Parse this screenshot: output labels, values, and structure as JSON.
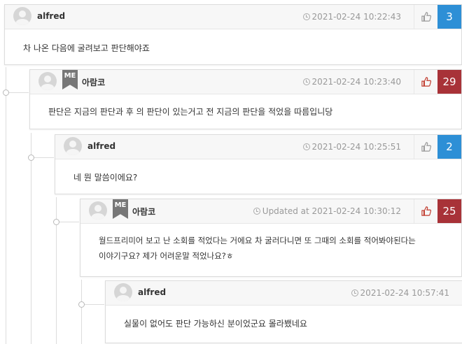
{
  "comments": [
    {
      "author": "alfred",
      "is_me": false,
      "time": "2021-02-24 10:22:43",
      "likes": "3",
      "liked": false,
      "text": "차 나온 다음에 굴려보고 판단해야죠"
    },
    {
      "author": "아람코",
      "is_me": true,
      "time": "2021-02-24 10:23:40",
      "likes": "29",
      "liked": true,
      "text": "판단은 지금의 판단과 후 의 판단이 있는거고 전 지금의 판단을 적었을 따름입니당"
    },
    {
      "author": "alfred",
      "is_me": false,
      "time": "2021-02-24 10:25:51",
      "likes": "2",
      "liked": false,
      "text": "네 뭔 말씀이에요?"
    },
    {
      "author": "아람코",
      "is_me": true,
      "time": "Updated at 2021-02-24 10:30:12",
      "likes": "25",
      "liked": true,
      "text_line1": "월드프리미어 보고 난 소회를 적었다는 거에요 차 굴러다니면 또 그때의 소회를 적어봐야된다는",
      "text_line2": "이야기구요? 제가 어려운말 적었나요?ㅎ"
    },
    {
      "author": "alfred",
      "is_me": false,
      "time": "2021-02-24 10:57:41",
      "likes": "",
      "liked": false,
      "text": "실물이 없어도 판단 가능하신 분이었군요 몰라뵀네요"
    }
  ],
  "me_badge": "ME",
  "colors": {
    "likes_default": "#2d8fd6",
    "likes_liked": "#a83238",
    "liked_icon": "#c0392b"
  },
  "icons": {
    "like": "thumbs-up-icon",
    "time": "clock-icon",
    "avatar": "avatar-placeholder"
  }
}
